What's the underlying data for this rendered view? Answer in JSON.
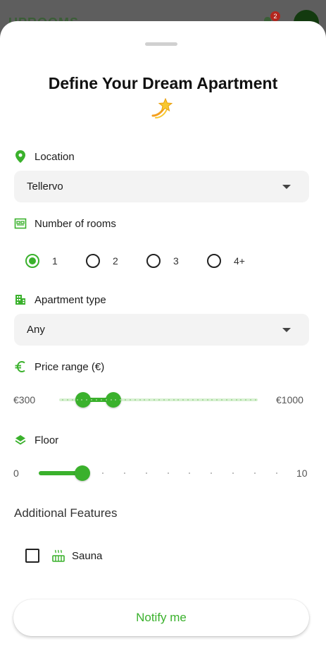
{
  "background": {
    "brand": "UPROOMS",
    "notifications_count": "2"
  },
  "sheet": {
    "title": "Define Your Dream Apartment",
    "title_emoji": "dizzy-star-emoji",
    "location": {
      "label": "Location",
      "icon": "location-pin-icon",
      "value": "Tellervo"
    },
    "rooms": {
      "label": "Number of rooms",
      "icon": "bed-icon",
      "options": [
        "1",
        "2",
        "3",
        "4+"
      ],
      "selected": "1"
    },
    "apartment_type": {
      "label": "Apartment type",
      "icon": "apartment-building-icon",
      "value": "Any"
    },
    "price": {
      "label": "Price range (€)",
      "icon": "euro-icon",
      "min_label": "€300",
      "max_label": "€1000",
      "min": 300,
      "max": 1000,
      "low": 350,
      "high": 470
    },
    "floor": {
      "label": "Floor",
      "icon": "layers-icon",
      "min_label": "0",
      "max_label": "10",
      "min": 0,
      "max": 10,
      "value": 1
    },
    "additional": {
      "title": "Additional Features",
      "features": [
        {
          "label": "Sauna",
          "icon": "sauna-icon",
          "checked": false
        }
      ]
    },
    "notify_label": "Notify me"
  },
  "colors": {
    "accent": "#3ab12c",
    "accent_light": "#d8f0d2",
    "sheet_bg": "#ffffff",
    "field_bg": "#f3f3f3"
  }
}
